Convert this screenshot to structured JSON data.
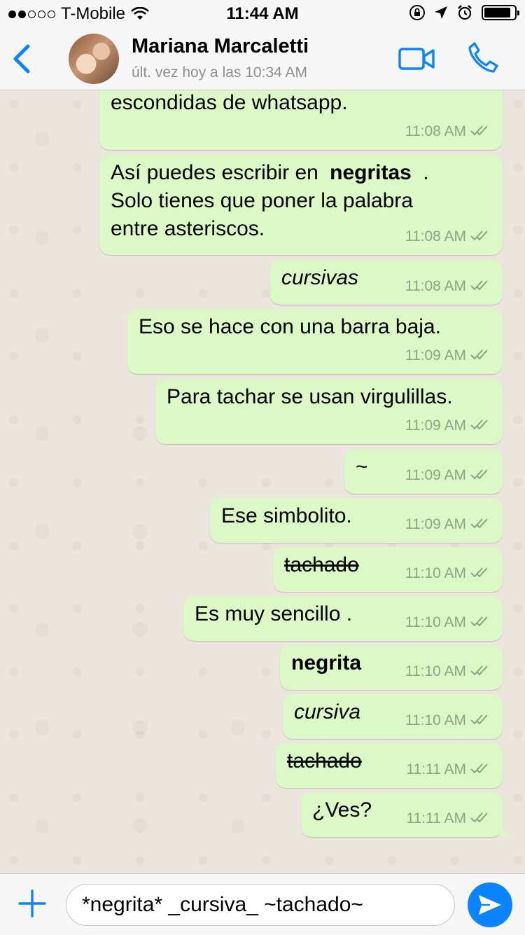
{
  "status_bar": {
    "carrier": "T-Mobile",
    "time": "11:44 AM",
    "battery_level": 0.9
  },
  "header": {
    "contact_name": "Mariana Marcaletti",
    "last_seen": "últ. vez hoy a las 10:34 AM"
  },
  "messages": [
    {
      "parts": [
        {
          "text": "escondidas de whatsapp.",
          "style": "normal"
        }
      ],
      "time": "11:08 AM"
    },
    {
      "parts": [
        {
          "text": "Así puedes escribir en ",
          "style": "normal"
        },
        {
          "text": "negritas",
          "style": "bold"
        },
        {
          "text": " .",
          "style": "normal"
        },
        {
          "text": "Solo tienes que poner la palabra",
          "style": "normal"
        },
        {
          "text": "entre asteriscos.",
          "style": "normal"
        }
      ],
      "time": "11:08 AM"
    },
    {
      "parts": [
        {
          "text": "cursivas",
          "style": "italic"
        }
      ],
      "time": "11:08 AM"
    },
    {
      "parts": [
        {
          "text": "Eso se hace con una barra baja.",
          "style": "normal"
        }
      ],
      "time": "11:09 AM"
    },
    {
      "parts": [
        {
          "text": "Para tachar se usan virgulillas.",
          "style": "normal"
        }
      ],
      "time": "11:09 AM"
    },
    {
      "parts": [
        {
          "text": "~",
          "style": "normal"
        }
      ],
      "time": "11:09 AM"
    },
    {
      "parts": [
        {
          "text": "Ese simbolito.",
          "style": "normal"
        }
      ],
      "time": "11:09 AM"
    },
    {
      "parts": [
        {
          "text": "tachado",
          "style": "strike"
        }
      ],
      "time": "11:10 AM"
    },
    {
      "parts": [
        {
          "text": "Es muy sencillo .",
          "style": "normal"
        }
      ],
      "time": "11:10 AM"
    },
    {
      "parts": [
        {
          "text": "negrita",
          "style": "bold"
        }
      ],
      "time": "11:10 AM"
    },
    {
      "parts": [
        {
          "text": "cursiva",
          "style": "italic"
        }
      ],
      "time": "11:10 AM"
    },
    {
      "parts": [
        {
          "text": "tachado",
          "style": "strike"
        }
      ],
      "time": "11:11 AM"
    },
    {
      "parts": [
        {
          "text": "¿Ves?",
          "style": "normal"
        }
      ],
      "time": "11:11 AM"
    }
  ],
  "input": {
    "value": "*negrita* _cursiva_ ~tachado~"
  },
  "colors": {
    "accent": "#0a84ff",
    "outgoing_bubble": "#dcf8c6",
    "chat_background": "#ece5dd",
    "read_ticks": "#8ea385"
  },
  "icons": [
    "back-chevron-icon",
    "video-call-icon",
    "phone-call-icon",
    "plus-icon",
    "send-icon",
    "wifi-icon",
    "lock-rotation-icon",
    "location-arrow-icon",
    "alarm-icon",
    "battery-icon",
    "double-check-icon"
  ]
}
